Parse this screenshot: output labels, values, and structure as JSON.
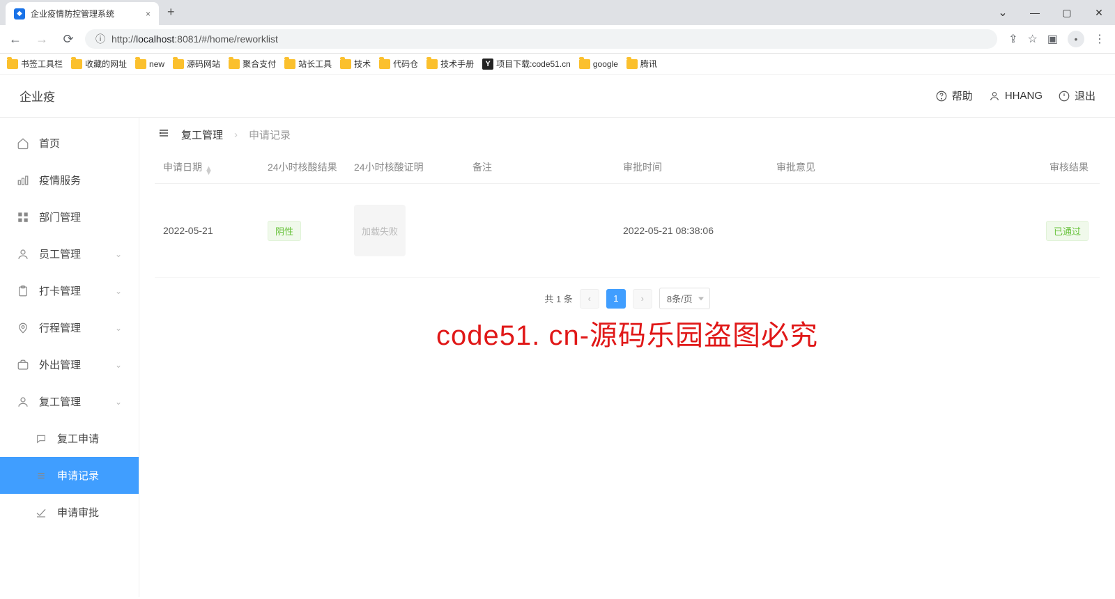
{
  "browser": {
    "tab": {
      "title": "企业疫情防控管理系统"
    },
    "url_host": "localhost",
    "url_port_path": ":8081/#/home/reworklist",
    "url_prefix": "http://",
    "bookmarks": [
      {
        "label": "书签工具栏",
        "kind": "folder"
      },
      {
        "label": "收藏的网址",
        "kind": "folder"
      },
      {
        "label": "new",
        "kind": "folder"
      },
      {
        "label": "源码网站",
        "kind": "folder"
      },
      {
        "label": "聚合支付",
        "kind": "folder"
      },
      {
        "label": "站长工具",
        "kind": "folder"
      },
      {
        "label": "技术",
        "kind": "folder"
      },
      {
        "label": "代码仓",
        "kind": "folder"
      },
      {
        "label": "技术手册",
        "kind": "folder"
      },
      {
        "label": "项目下载:code51.cn",
        "kind": "y"
      },
      {
        "label": "google",
        "kind": "folder"
      },
      {
        "label": "腾讯",
        "kind": "folder"
      }
    ]
  },
  "app": {
    "logo": "企业疫",
    "actions": {
      "help": "帮助",
      "user": "HHANG",
      "logout": "退出"
    }
  },
  "sidebar": {
    "items": [
      {
        "icon": "home",
        "label": "首页",
        "expand": false
      },
      {
        "icon": "chart",
        "label": "疫情服务",
        "expand": false
      },
      {
        "icon": "grid",
        "label": "部门管理",
        "expand": false
      },
      {
        "icon": "user",
        "label": "员工管理",
        "expand": true
      },
      {
        "icon": "clipboard",
        "label": "打卡管理",
        "expand": true
      },
      {
        "icon": "pin",
        "label": "行程管理",
        "expand": true
      },
      {
        "icon": "briefcase",
        "label": "外出管理",
        "expand": true
      },
      {
        "icon": "user",
        "label": "复工管理",
        "expand": true
      }
    ],
    "sub": [
      {
        "icon": "chat",
        "label": "复工申请",
        "active": false
      },
      {
        "icon": "list",
        "label": "申请记录",
        "active": true
      },
      {
        "icon": "check",
        "label": "申请审批",
        "active": false
      }
    ]
  },
  "breadcrumb": {
    "a": "复工管理",
    "b": "申请记录"
  },
  "table": {
    "columns": {
      "date": "申请日期",
      "result": "24小时核酸结果",
      "proof": "24小时核酸证明",
      "remark": "备注",
      "time": "审批时间",
      "opinion": "审批意见",
      "status": "审核结果"
    },
    "rows": [
      {
        "date": "2022-05-21",
        "result_tag": "阴性",
        "proof_text": "加载失败",
        "remark": "",
        "time": "2022-05-21 08:38:06",
        "opinion": "",
        "status_tag": "已通过"
      }
    ]
  },
  "pagination": {
    "total_text": "共 1 条",
    "current": "1",
    "page_size_label": "8条/页"
  },
  "watermark": "code51. cn-源码乐园盗图必究"
}
